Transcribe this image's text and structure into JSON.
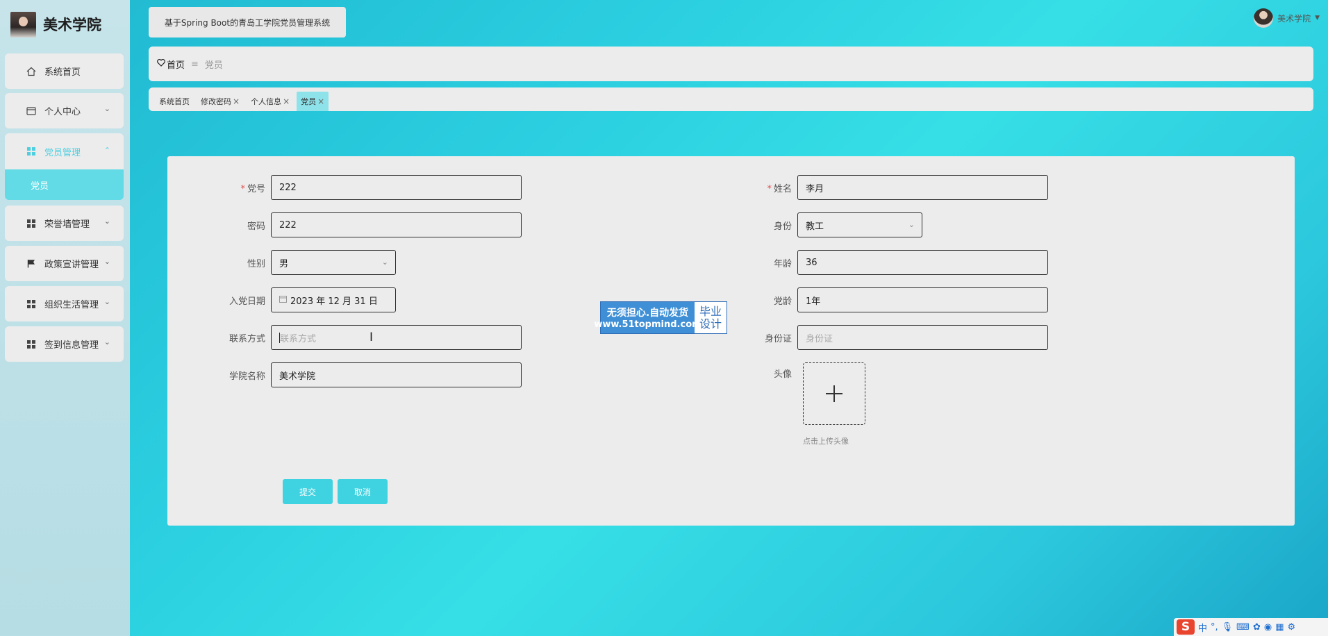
{
  "brand": {
    "title": "美术学院",
    "avatar_icon": "user-photo-icon"
  },
  "sidebar": {
    "items": [
      {
        "label": "系统首页",
        "icon": "home-icon"
      },
      {
        "label": "个人中心",
        "icon": "id-card-icon"
      },
      {
        "label": "党员管理",
        "icon": "grid-icon"
      },
      {
        "label": "荣誉墙管理",
        "icon": "grid-icon"
      },
      {
        "label": "政策宣讲管理",
        "icon": "flag-icon"
      },
      {
        "label": "组织生活管理",
        "icon": "grid-icon"
      },
      {
        "label": "签到信息管理",
        "icon": "grid-icon"
      }
    ],
    "submenu": {
      "label": "党员"
    }
  },
  "header": {
    "system_title": "基于Spring Boot的青岛工学院党员管理系统",
    "user_name": "美术学院"
  },
  "breadcrumb": {
    "home": "首页",
    "current": "党员"
  },
  "tabs": [
    {
      "label": "系统首页",
      "closable": false
    },
    {
      "label": "修改密码",
      "closable": true
    },
    {
      "label": "个人信息",
      "closable": true
    },
    {
      "label": "党员",
      "closable": true,
      "active": true
    }
  ],
  "form": {
    "party_no": {
      "label": "党号",
      "value": "222",
      "required": true
    },
    "name": {
      "label": "姓名",
      "value": "李月",
      "required": true
    },
    "password": {
      "label": "密码",
      "value": "222"
    },
    "identity": {
      "label": "身份",
      "value": "教工"
    },
    "gender": {
      "label": "性别",
      "value": "男"
    },
    "age": {
      "label": "年龄",
      "value": "36"
    },
    "join_date": {
      "label": "入党日期",
      "value": "2023 年 12 月 31 日"
    },
    "party_age": {
      "label": "党龄",
      "value": "1年"
    },
    "contact": {
      "label": "联系方式",
      "placeholder": "联系方式"
    },
    "id_card": {
      "label": "身份证",
      "placeholder": "身份证"
    },
    "college": {
      "label": "学院名称",
      "value": "美术学院"
    },
    "avatar": {
      "label": "头像",
      "hint": "点击上传头像"
    },
    "submit_label": "提交",
    "cancel_label": "取消"
  },
  "watermark": {
    "line1": "无须担心.自动发货",
    "line2": "www.51topmind.com",
    "right1": "毕业",
    "right2": "设计"
  },
  "ime": {
    "logo": "S",
    "lang": "中"
  },
  "colors": {
    "accent": "#3fd2e0",
    "active_menu": "#62dbe6",
    "required": "#e15050"
  }
}
